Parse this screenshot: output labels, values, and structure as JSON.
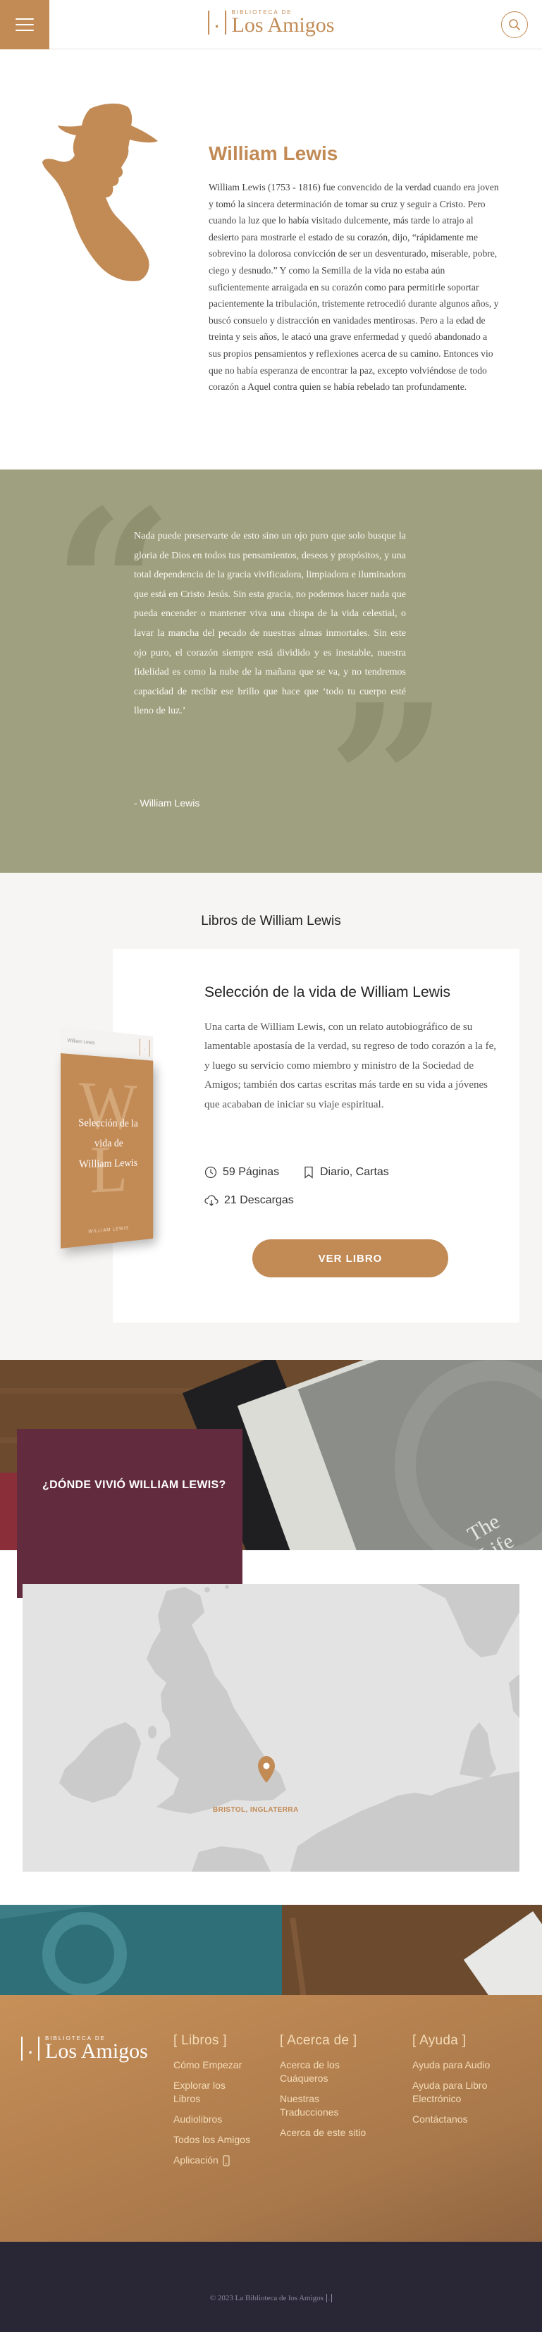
{
  "header": {
    "logo_small": "BIBLIOTECA DE",
    "logo_big": "Los Amigos",
    "logo_mark": "[.]"
  },
  "author": {
    "name": "William Lewis",
    "bio": "William Lewis (1753 - 1816) fue convencido de la verdad cuando era joven y tomó la sincera determinación de tomar su cruz y seguir a Cristo. Pero cuando la luz que lo había visitado dulcemente, más tarde lo atrajo al desierto para mostrarle el estado de su corazón, dijo, “rápidamente me sobrevino la dolorosa convicción de ser un desventurado, miserable, pobre, ciego y desnudo.” Y como la Semilla de la vida no estaba aún suficientemente arraigada en su corazón como para permitirle soportar pacientemente la tribulación, tristemente retrocedió durante algunos años, y buscó consuelo y distracción en vanidades mentirosas. Pero a la edad de treinta y seis años, le atacó una grave enfermedad y quedó abandonado a sus propios pensamientos y reflexiones acerca de su camino. Entonces vio que no había esperanza de encontrar la paz, excepto volviéndose de todo corazón a Aquel contra quien se había rebelado tan profundamente."
  },
  "quote": {
    "text": "Nada puede preservarte de esto sino un ojo puro que solo busque la gloria de Dios en todos tus pensamientos, deseos y propósitos, y una total dependencia de la gracia vivificadora, limpiadora e iluminadora que está en Cristo Jesús. Sin esta gracia, no podemos hacer nada que pueda encender o mantener viva una chispa de la vida celestial, o lavar la mancha del pecado de nuestras almas inmortales. Sin este ojo puro, el corazón siempre está dividido y es inestable, nuestra fidelidad es como la nube de la mañana que se va, y no tendremos capacidad de recibir ese brillo que hace que ‘todo tu cuerpo esté lleno de luz.’",
    "author": "- William Lewis"
  },
  "books": {
    "section_title": "Libros de William Lewis",
    "items": [
      {
        "title": "Selección de la vida de William Lewis",
        "description": "Una carta de William Lewis, con un relato autobiográfico de su lamentable apostasía de la verdad, su regreso de todo corazón a la fe, y luego su servicio como miembro y ministro de la Sociedad de Amigos; también dos cartas escritas más tarde en su vida a jóvenes que acababan de iniciar su viaje espiritual.",
        "pages": "59 Páginas",
        "tags": "Diario, Cartas",
        "downloads": "21 Descargas",
        "button": "VER LIBRO",
        "cover": {
          "header": "William Lewis",
          "initials_top": "W",
          "initials_bottom": "L",
          "title_line1": "Selección de la",
          "title_line2": "vida de",
          "title_line3": "William Lewis",
          "footer": "WILLIAM LEWIS"
        }
      }
    ]
  },
  "where": {
    "title": "¿DÓNDE VIVIÓ WILLIAM LEWIS?",
    "map_label": "BRISTOL, INGLATERRA",
    "photo_book_text": "The Life"
  },
  "footer": {
    "logo_small": "BIBLIOTECA DE",
    "logo_big": "Los Amigos",
    "columns": [
      {
        "title": "[ Libros ]",
        "links": [
          "Cómo Empezar",
          "Explorar los Libros",
          "Audiolibros",
          "Todos los Amigos",
          "Aplicación"
        ]
      },
      {
        "title": "[ Acerca de ]",
        "links": [
          "Acerca de los Cuáqueros",
          "Nuestras Traducciones",
          "Acerca de este sitio"
        ]
      },
      {
        "title": "[ Ayuda ]",
        "links": [
          "Ayuda para Audio",
          "Ayuda para Libro Electrónico",
          "Contáctanos"
        ]
      }
    ],
    "copyright": "© 2023 La Biblioteca de los Amigos"
  },
  "colors": {
    "accent": "#c28a55",
    "quote_bg": "#9ea07f",
    "where_box": "#622c3e",
    "footer_bottom": "#292736"
  }
}
